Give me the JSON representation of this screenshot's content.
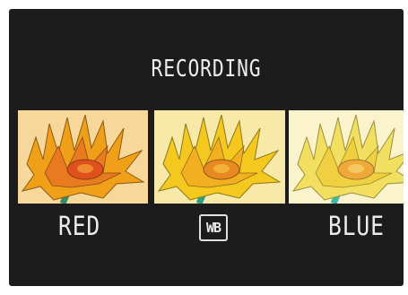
{
  "screen": {
    "title": "RECORDING",
    "background": "#1c1c1c"
  },
  "bracket": {
    "left_label": "RED",
    "center_badge": "WB",
    "right_label": "BLUE"
  },
  "thumbnails": [
    {
      "name": "red-shifted",
      "icon": "flower-image",
      "tint": "#f0a018"
    },
    {
      "name": "normal",
      "icon": "flower-image",
      "tint": "#f5c820"
    },
    {
      "name": "blue-shifted",
      "icon": "flower-image",
      "tint": "#f2df60"
    }
  ]
}
